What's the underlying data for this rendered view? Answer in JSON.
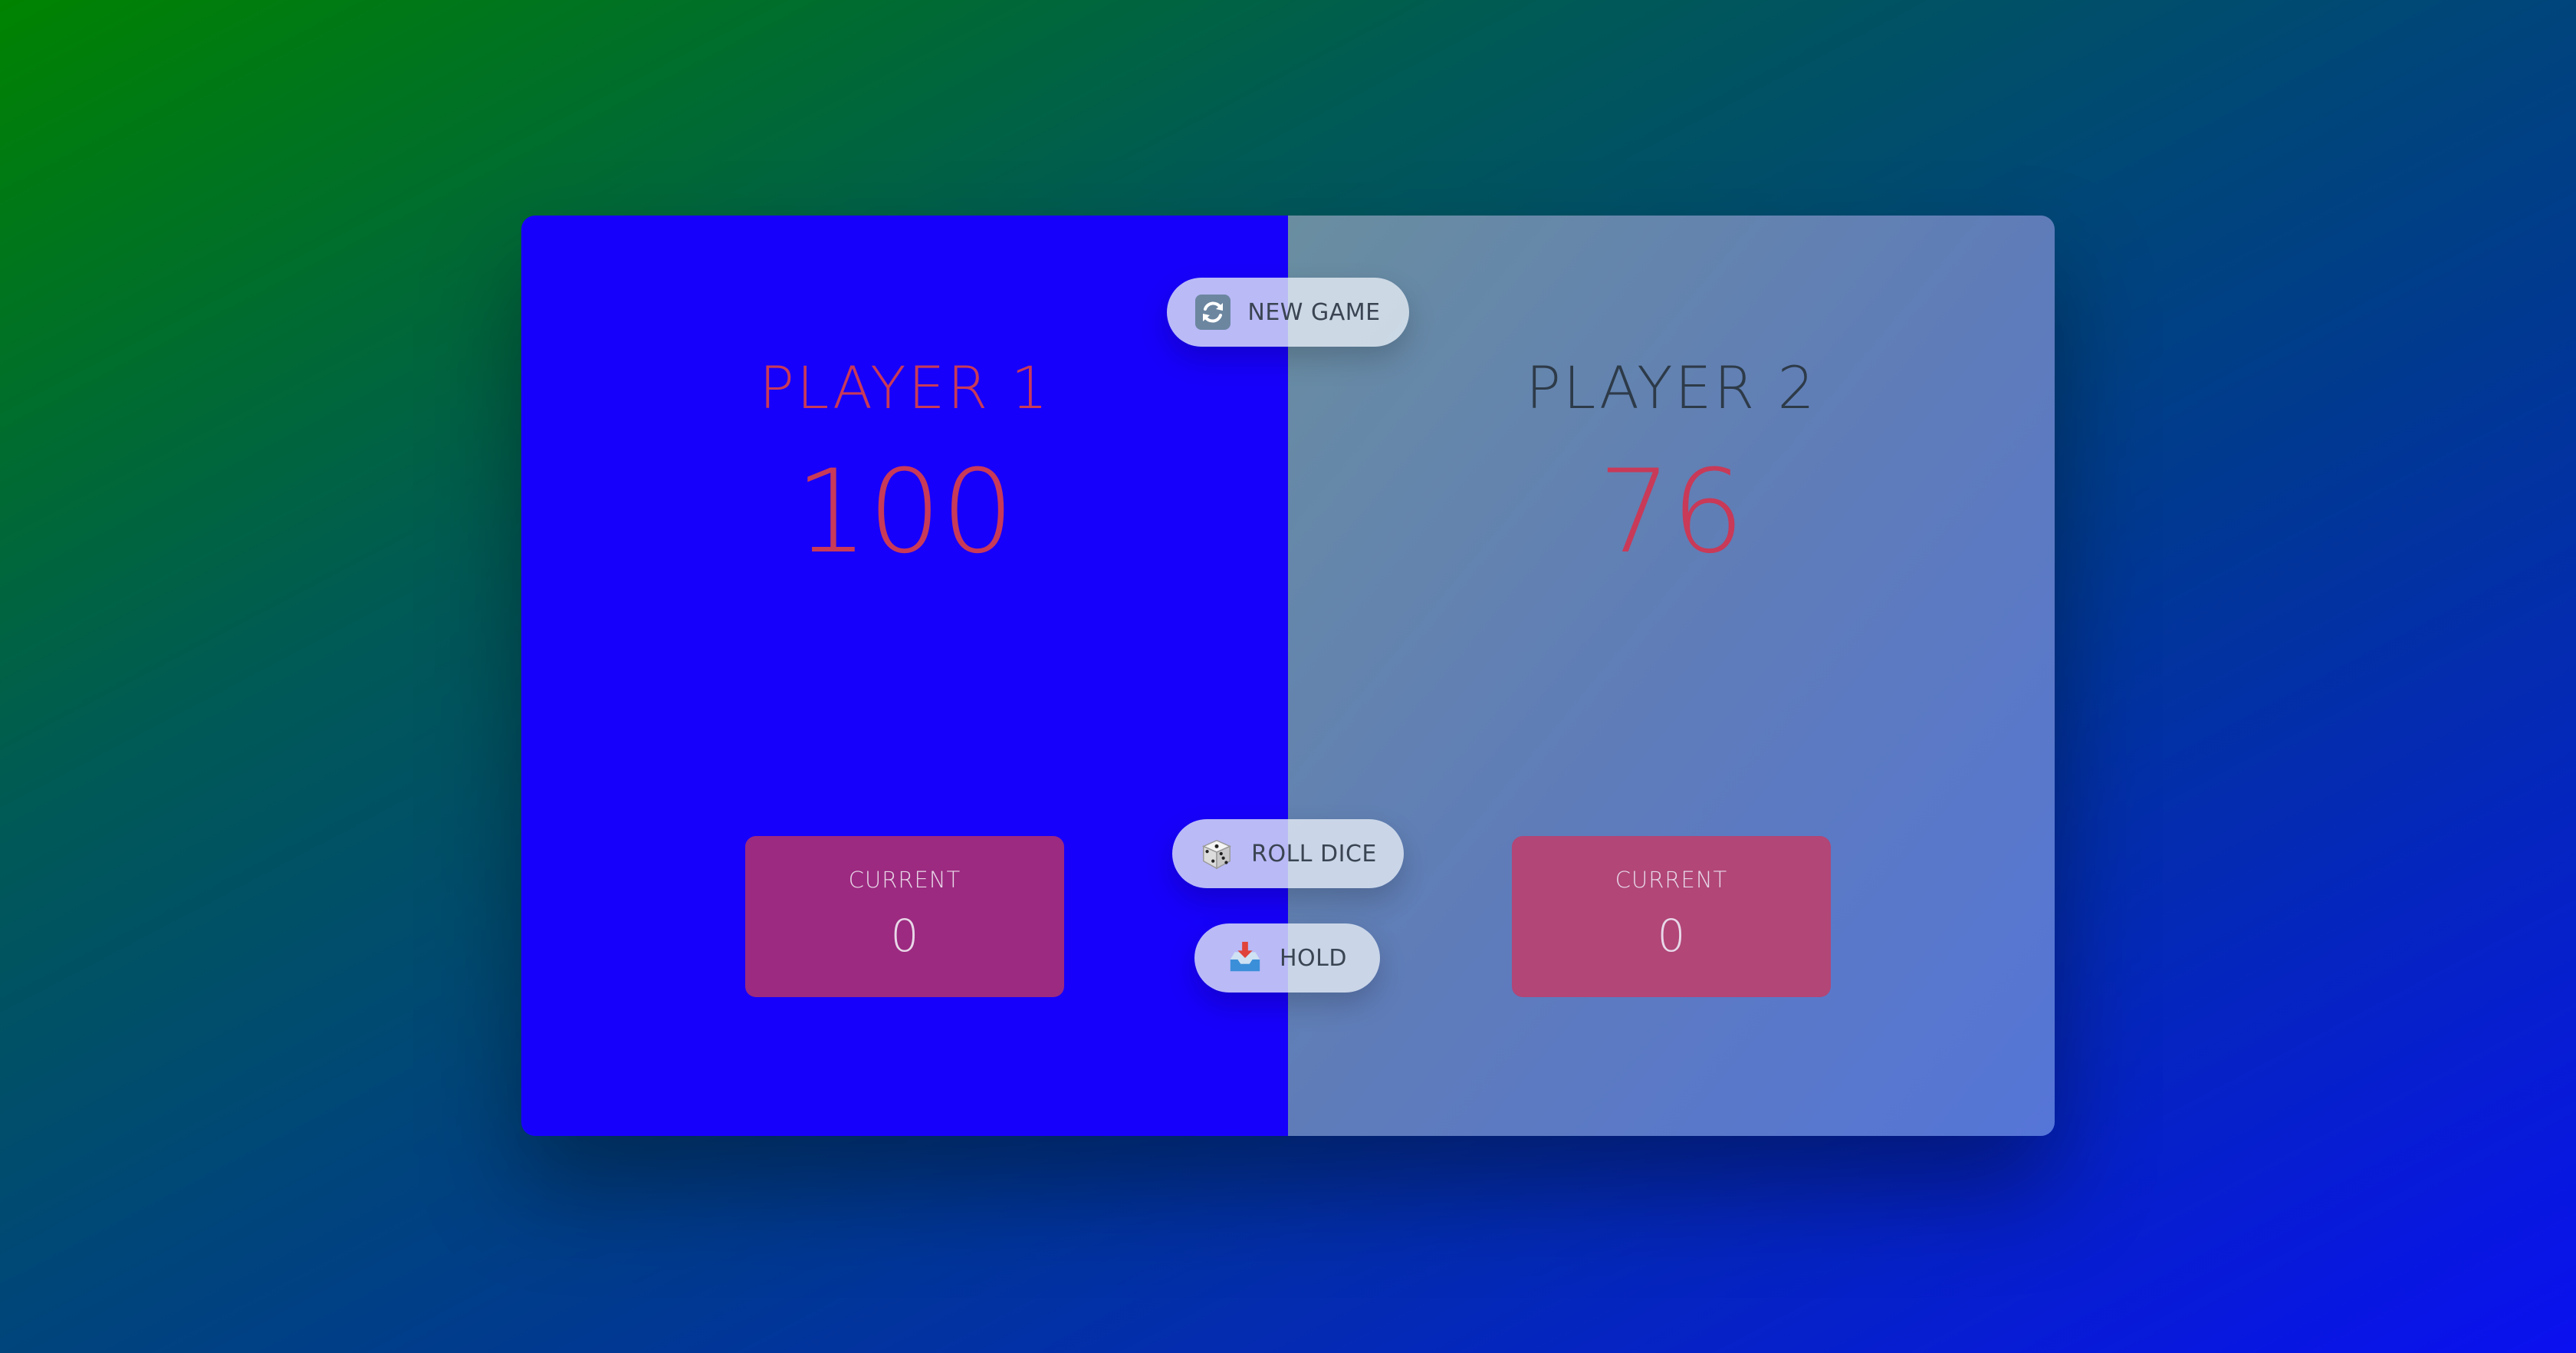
{
  "players": [
    {
      "name": "PLAYER 1",
      "score": "100",
      "current_label": "CURRENT",
      "current_score": "0"
    },
    {
      "name": "PLAYER 2",
      "score": "76",
      "current_label": "CURRENT",
      "current_score": "0"
    }
  ],
  "buttons": {
    "new_game": {
      "label": "NEW GAME",
      "icon": "refresh-icon"
    },
    "roll_dice": {
      "label": "ROLL DICE",
      "icon": "dice-icon"
    },
    "hold": {
      "label": "HOLD",
      "icon": "inbox-tray-icon"
    }
  },
  "colors": {
    "active_player_bg": "#1700fb",
    "score_color": "#c83a58",
    "current_box_p1": "#9c2a80",
    "current_box_p2": "#b14677"
  }
}
